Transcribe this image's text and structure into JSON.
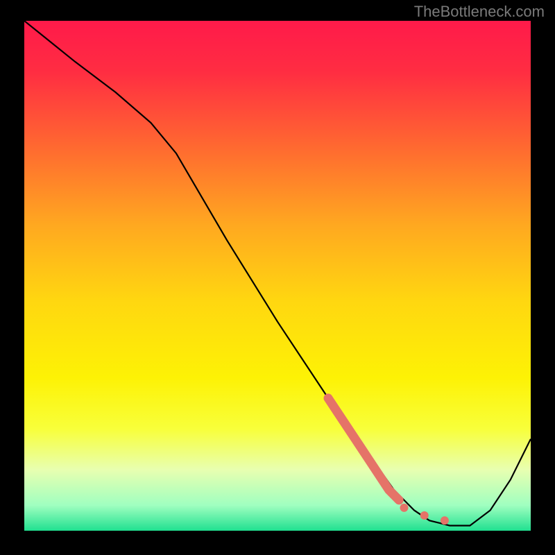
{
  "watermark": "TheBottleneck.com",
  "chart_data": {
    "type": "line",
    "title": "",
    "xlabel": "",
    "ylabel": "",
    "xlim": [
      0,
      100
    ],
    "ylim": [
      0,
      100
    ],
    "background": {
      "type": "vertical-gradient",
      "stops": [
        {
          "offset": 0.0,
          "color": "#ff1a4a"
        },
        {
          "offset": 0.1,
          "color": "#ff2d42"
        },
        {
          "offset": 0.25,
          "color": "#ff6a30"
        },
        {
          "offset": 0.4,
          "color": "#ffa820"
        },
        {
          "offset": 0.55,
          "color": "#ffd710"
        },
        {
          "offset": 0.7,
          "color": "#fdf205"
        },
        {
          "offset": 0.8,
          "color": "#f8ff3a"
        },
        {
          "offset": 0.88,
          "color": "#e8ffb0"
        },
        {
          "offset": 0.95,
          "color": "#a0ffc0"
        },
        {
          "offset": 1.0,
          "color": "#20e090"
        }
      ]
    },
    "series": [
      {
        "name": "bottleneck-curve",
        "color": "#000000",
        "x": [
          0,
          5,
          10,
          18,
          25,
          30,
          40,
          50,
          60,
          68,
          73,
          77,
          80,
          84,
          88,
          92,
          96,
          100
        ],
        "values": [
          100,
          96,
          92,
          86,
          80,
          74,
          57,
          41,
          26,
          15,
          8,
          4,
          2,
          1,
          1,
          4,
          10,
          18
        ]
      }
    ],
    "highlight_segment": {
      "name": "marker-band",
      "color": "#e57368",
      "x": [
        60,
        62,
        64,
        66,
        68,
        70,
        72,
        74
      ],
      "values": [
        26,
        23,
        20,
        17,
        14,
        11,
        8,
        6
      ]
    },
    "highlight_points": {
      "name": "marker-dots",
      "color": "#e57368",
      "points": [
        {
          "x": 75,
          "y": 4.5
        },
        {
          "x": 79,
          "y": 3
        },
        {
          "x": 83,
          "y": 2
        }
      ]
    }
  }
}
